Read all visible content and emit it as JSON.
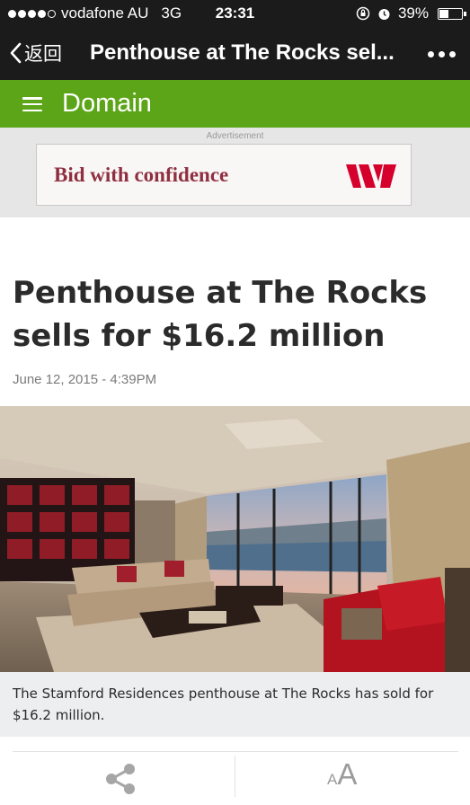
{
  "status_bar": {
    "carrier": "vodafone AU",
    "network": "3G",
    "time": "23:31",
    "battery_percent": "39%",
    "battery_level": 0.39
  },
  "nav": {
    "back_label": "返回",
    "title": "Penthouse at The Rocks sel..."
  },
  "domain_header": {
    "brand": "Domain",
    "color": "#5ca518"
  },
  "advert": {
    "label": "Advertisement",
    "text": "Bid with confidence",
    "logo_color": "#d5002b"
  },
  "article": {
    "title": "Penthouse at The Rocks sells for $16.2 million",
    "date": "June 12, 2015 - 4:39PM",
    "caption": "The Stamford Residences penthouse at The Rocks has sold for $16.2 million."
  },
  "toolbar": {
    "share_icon": "share-icon",
    "font_small": "A",
    "font_large": "A"
  }
}
